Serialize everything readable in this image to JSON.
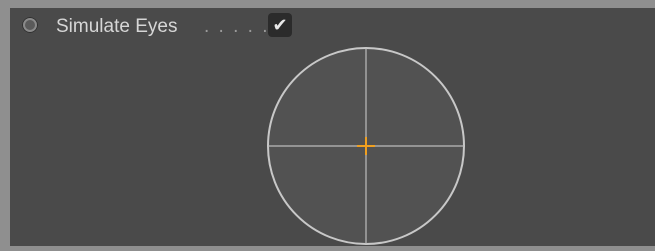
{
  "param": {
    "label": "Simulate Eyes",
    "dots": ". . . . .",
    "checked": true,
    "check_glyph": "✔"
  },
  "viewer": {
    "ring_color": "#c8c8c8",
    "crosshair_color": "#c8c8c8",
    "target_color": "#f0a020"
  }
}
